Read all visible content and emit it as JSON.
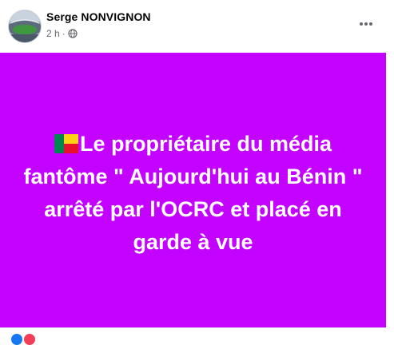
{
  "post": {
    "author": "Serge NONVIGNON",
    "time": "2 h",
    "separator": "·",
    "body_text": "Le propriétaire du média fantôme \" Aujourd'hui au Bénin \" arrêté par l'OCRC et placé en garde à vue",
    "leading_emoji": "flag-benin-icon",
    "background_color": "#c302ff"
  },
  "icons": {
    "privacy": "globe-icon",
    "menu": "more-options-icon"
  }
}
